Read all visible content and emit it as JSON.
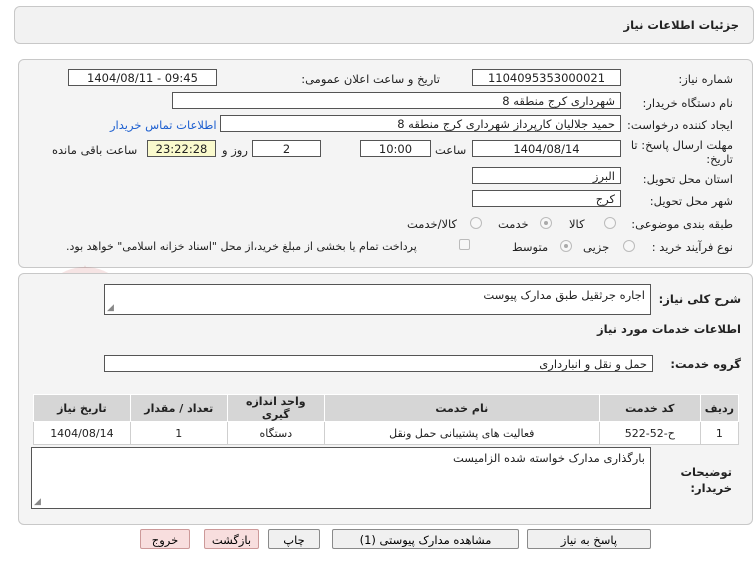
{
  "header": {
    "title": "جزئیات اطلاعات نیاز"
  },
  "form": {
    "need_number_label": "شماره نیاز:",
    "need_number": "1104095353000021",
    "announce_label": "تاریخ و ساعت اعلان عمومی:",
    "announce_value": "1404/08/11 - 09:45",
    "buyer_org_label": "نام دستگاه خریدار:",
    "buyer_org": "شهرداری کرج منطقه 8",
    "creator_label": "ایجاد کننده درخواست:",
    "creator": "حمید جلالیان کارپرداز شهرداری کرج منطقه 8",
    "contact_link": "اطلاعات تماس خریدار",
    "deadline_label_1": "مهلت ارسال پاسخ: تا",
    "deadline_label_2": "تاریخ:",
    "deadline_date": "1404/08/14",
    "time_label": "ساعت",
    "deadline_time": "10:00",
    "days_value": "2",
    "days_label": "روز و",
    "remaining_time": "23:22:28",
    "remaining_label": "ساعت باقی مانده",
    "province_label": "استان محل تحویل:",
    "province": "البرز",
    "city_label": "شهر محل تحویل:",
    "city": "کرج",
    "category_label": "طبقه بندی موضوعی:",
    "category_options": [
      "کالا",
      "خدمت",
      "کالا/خدمت"
    ],
    "category_selected": "خدمت",
    "process_label": "نوع فرآیند خرید :",
    "process_options": [
      "جزیی",
      "متوسط"
    ],
    "process_selected": "متوسط",
    "payment_note": "پرداخت تمام یا بخشی از مبلغ خرید،از محل \"اسناد خزانه اسلامی\" خواهد بود."
  },
  "summary": {
    "label": "شرح کلی نیاز:",
    "value": "اجاره جرثقیل طبق مدارک پیوست"
  },
  "services": {
    "section_title": "اطلاعات خدمات مورد نیاز",
    "group_label": "گروه خدمت:",
    "group_value": "حمل و نقل و انبارداری",
    "columns": [
      "ردیف",
      "کد خدمت",
      "نام خدمت",
      "واحد اندازه گیری",
      "تعداد / مقدار",
      "تاریخ نیاز"
    ],
    "rows": [
      [
        "1",
        "ح-52-522",
        "فعالیت های پشتیبانی حمل ونقل",
        "دستگاه",
        "1",
        "1404/08/14"
      ]
    ]
  },
  "buyer_notes": {
    "label_1": "توضیحات",
    "label_2": "خریدار:",
    "value": "بارگذاری مدارک خواسته شده الزامیست"
  },
  "buttons": {
    "reply": "پاسخ به نیاز",
    "view_docs": "مشاهده مدارک پیوستی (1)",
    "print": "چاپ",
    "back": "بازگشت",
    "exit": "خروج"
  },
  "watermark": {
    "text": "AriaTender.net"
  }
}
